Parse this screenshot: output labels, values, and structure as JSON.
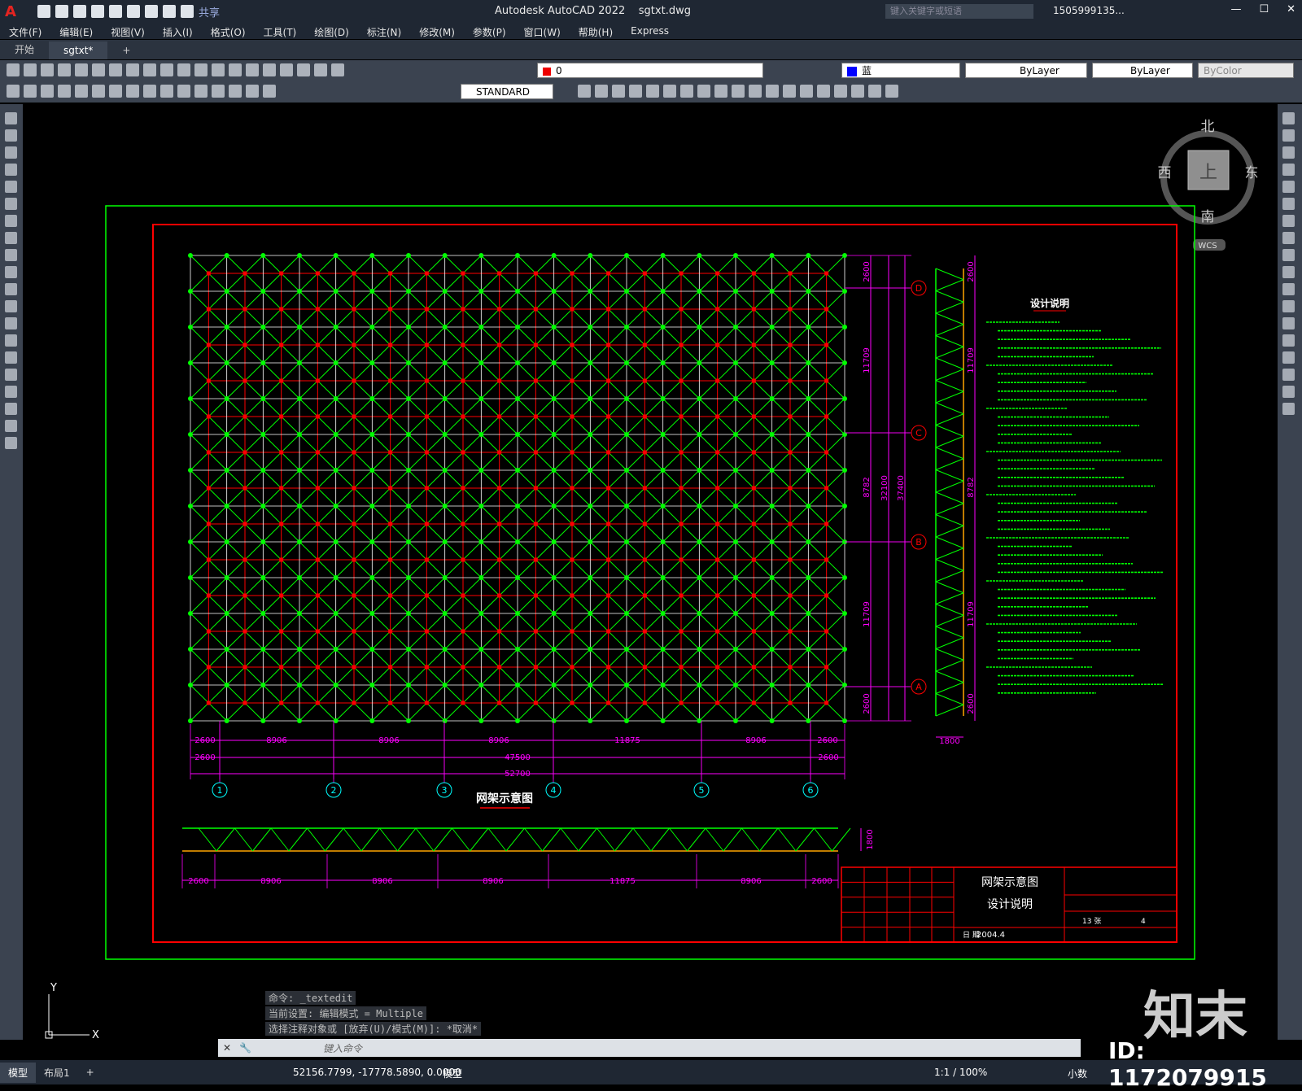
{
  "app": {
    "name": "Autodesk AutoCAD 2022",
    "file": "sgtxt.dwg",
    "share": "共享"
  },
  "search": {
    "placeholder": "键入关键字或短语"
  },
  "user": {
    "name": "1505999135..."
  },
  "menu": [
    "文件(F)",
    "编辑(E)",
    "视图(V)",
    "插入(I)",
    "格式(O)",
    "工具(T)",
    "绘图(D)",
    "标注(N)",
    "修改(M)",
    "参数(P)",
    "窗口(W)",
    "帮助(H)",
    "Express"
  ],
  "tabs": [
    "开始",
    "sgtxt*"
  ],
  "toolbar": {
    "layer": "0",
    "color": "蓝",
    "linetype": "ByLayer",
    "lineweight": "ByLayer",
    "plotstyle": "ByColor",
    "textstyle": "STANDARD"
  },
  "viewcube": {
    "north": "北",
    "south": "南",
    "east": "东",
    "west": "西",
    "top": "上",
    "wcs": "WCS"
  },
  "drawing": {
    "colors": {
      "frame": "#00ff00",
      "border": "#ff0000",
      "grid": "#00ff00",
      "dim": "#ff00ff",
      "axis": "#00ffff",
      "text": "#00ff00",
      "white": "#ffffff"
    },
    "plan_title": "网架示意图",
    "notes_title": "设计说明",
    "top_dims": [
      "2600",
      "8906",
      "8906",
      "8906",
      "11875",
      "8906",
      "2600"
    ],
    "total_row": [
      "2600",
      "47500",
      "2600"
    ],
    "overall": "52700",
    "axis_labels": [
      "1",
      "2",
      "3",
      "4",
      "5",
      "6"
    ],
    "row_axis_labels": [
      "D",
      "C",
      "B",
      "A"
    ],
    "right_dims": [
      "2600",
      "11709",
      "8782",
      "11709",
      "2600"
    ],
    "right_total": [
      "32100",
      "37400"
    ],
    "side_top": "2600",
    "side_dims": [
      "11709",
      "8782",
      "11709"
    ],
    "side_bottom": "2600",
    "side_width": "1800",
    "elev_height": "1800",
    "elev_dims": [
      "2600",
      "8906",
      "8906",
      "8906",
      "11875",
      "8906",
      "2600"
    ],
    "titleblock": {
      "name1": "网架示意图",
      "name2": "设计说明",
      "date_label": "日 期",
      "date": "2004.4",
      "sheet": "13 张",
      "sheet_no": "4"
    }
  },
  "commands": [
    "命令: _textedit",
    "当前设置: 编辑模式 = Multiple",
    "选择注释对象或 [放弃(U)/模式(M)]: *取消*"
  ],
  "command_placeholder": "键入命令",
  "status": {
    "model_tab": "模型",
    "layout_tab": "布局1",
    "coords": "52156.7799, -17778.5890, 0.0000",
    "space": "模型",
    "scale": "1:1 / 100%",
    "units": "小数"
  },
  "watermark": {
    "logo": "知末",
    "id": "ID: 1172079915"
  }
}
